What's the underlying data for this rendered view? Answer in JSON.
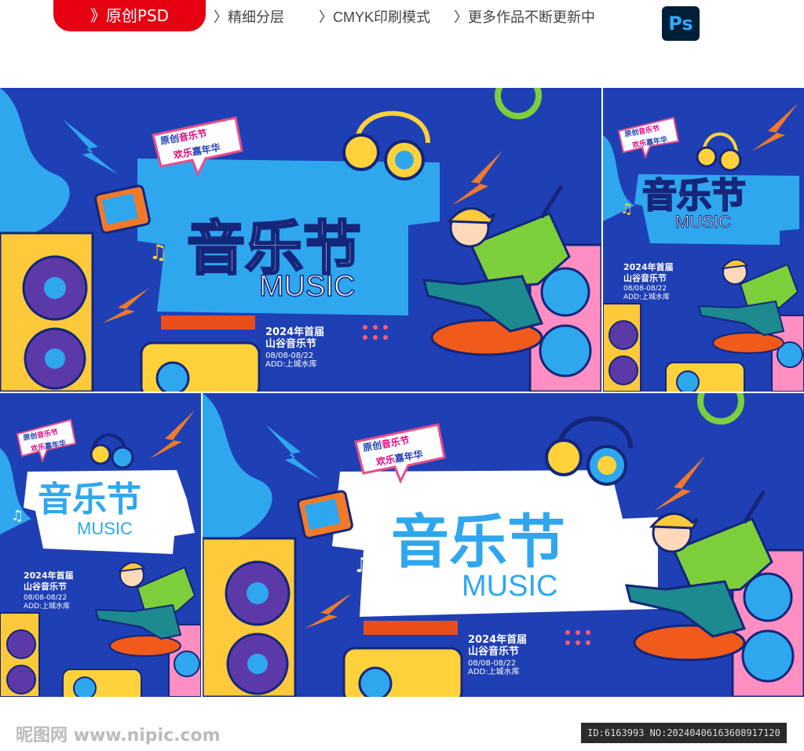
{
  "header": {
    "badge": "》原创PSD",
    "features": [
      "〉精细分层",
      "〉CMYK印刷模式",
      "〉更多作品不断更新中"
    ],
    "ps_logo": "Ps"
  },
  "poster": {
    "bubble_line1_a": "原创",
    "bubble_line1_b": "音乐节",
    "bubble_line2_a": "欢乐",
    "bubble_line2_b": "嘉年华",
    "title_cn": "音乐节",
    "title_en": "MUSIC",
    "event_line1": "2024年首届",
    "event_line2": "山谷音乐节",
    "event_date": "08/08-08/22",
    "event_address": "ADD:上城水库"
  },
  "footer": {
    "watermark": "昵图网 www.nipic.com",
    "id_text": "ID:6163993 NO:20240406163608917120"
  },
  "colors": {
    "bg_blue": "#1f3fb5",
    "accent_red": "#e60012",
    "light_blue": "#2ea7ef",
    "yellow": "#ffd23c",
    "orange": "#f07a2a",
    "green": "#7ccf3a",
    "pink": "#ff6fb0"
  }
}
